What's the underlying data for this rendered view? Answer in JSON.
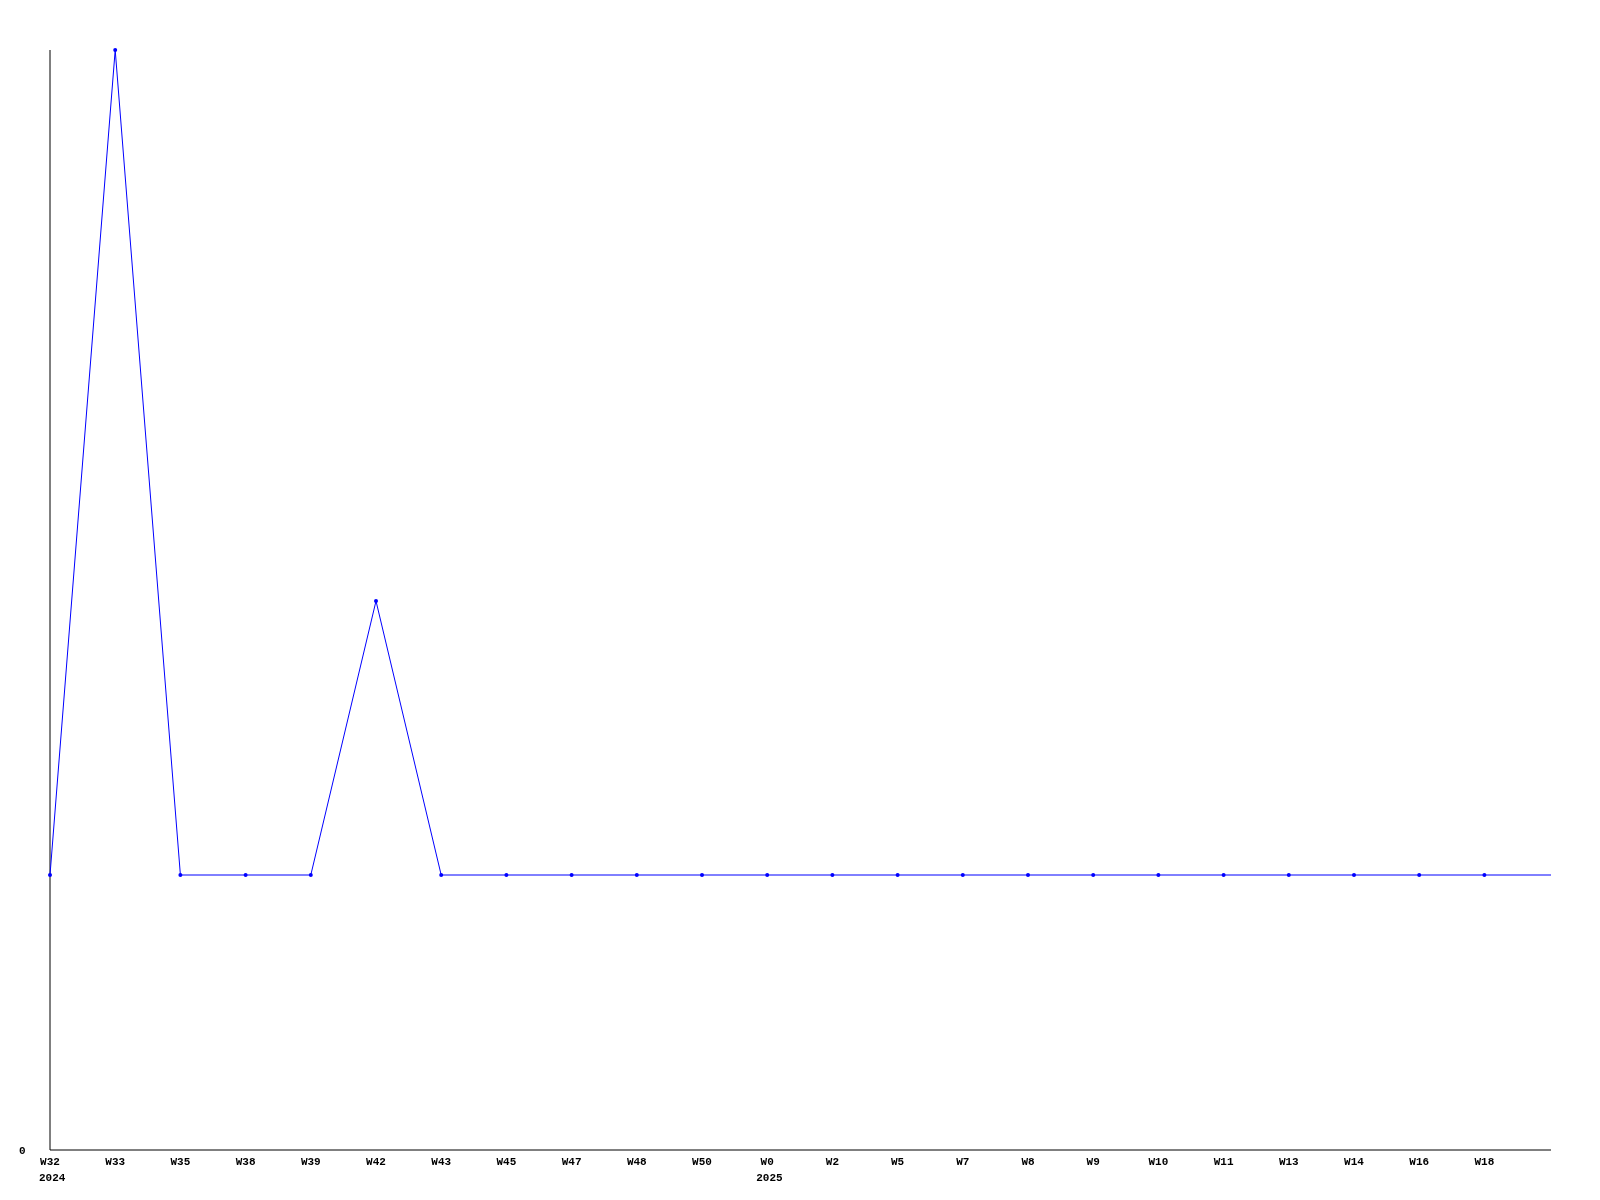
{
  "y_axis": {
    "tick_label": "0"
  },
  "x_axis": {
    "ticks": [
      {
        "label": "W32",
        "year": "2024"
      },
      {
        "label": "W33"
      },
      {
        "label": "W35"
      },
      {
        "label": "W38"
      },
      {
        "label": "W39"
      },
      {
        "label": "W42"
      },
      {
        "label": "W43"
      },
      {
        "label": "W45"
      },
      {
        "label": "W47"
      },
      {
        "label": "W48"
      },
      {
        "label": "W50"
      },
      {
        "label": "W0",
        "year": "2025"
      },
      {
        "label": "W2"
      },
      {
        "label": "W5"
      },
      {
        "label": "W7"
      },
      {
        "label": "W8"
      },
      {
        "label": "W9"
      },
      {
        "label": "W10"
      },
      {
        "label": "W11"
      },
      {
        "label": "W13"
      },
      {
        "label": "W14"
      },
      {
        "label": "W16"
      },
      {
        "label": "W18"
      }
    ]
  }
}
